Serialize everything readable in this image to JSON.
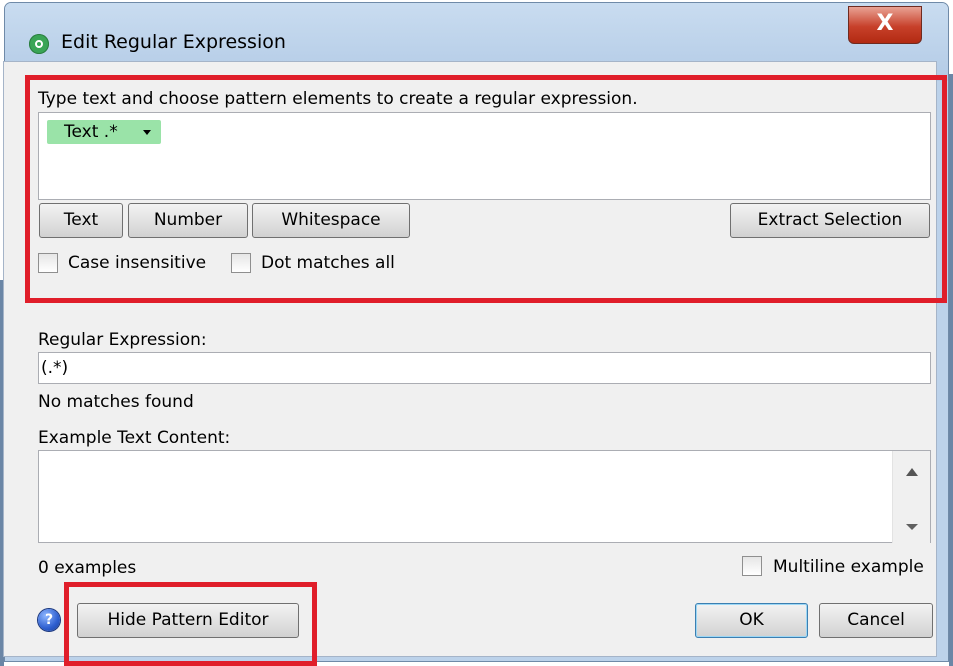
{
  "window": {
    "title": "Edit Regular Expression",
    "close_label": "X"
  },
  "pattern_editor": {
    "instruction": "Type text and choose pattern elements to create a regular expression.",
    "token_label": "Text .*",
    "buttons": {
      "text": "Text",
      "number": "Number",
      "whitespace": "Whitespace",
      "extract_selection": "Extract Selection"
    },
    "case_insensitive_label": "Case insensitive",
    "case_insensitive_checked": false,
    "dot_matches_all_label": "Dot matches all",
    "dot_matches_all_checked": false
  },
  "regex": {
    "label": "Regular Expression:",
    "value": "(.*)",
    "status": "No matches found"
  },
  "example": {
    "label": "Example Text Content:",
    "value": "",
    "count_label": "0 examples",
    "multiline_label": "Multiline example",
    "multiline_checked": false
  },
  "footer": {
    "help_glyph": "?",
    "hide_pattern_editor_label": "Hide Pattern Editor",
    "ok_label": "OK",
    "cancel_label": "Cancel"
  },
  "colors": {
    "highlight_red": "#e01e2a",
    "token_green": "#9ae3a8",
    "title_bar_blue": "#bcd2ea",
    "close_red": "#c7402a"
  },
  "icons": {
    "app": "app-icon",
    "close": "close-icon",
    "help": "help-icon",
    "token_dropdown": "chevron-down-icon"
  }
}
